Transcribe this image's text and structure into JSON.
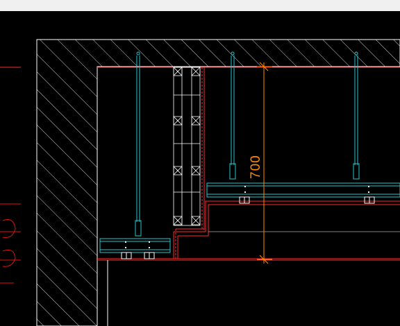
{
  "drawing": {
    "dimension_value": "700",
    "background_color": "#000000",
    "colors": {
      "wall_hatch": "#ffffff",
      "ceiling_line": "#ff2a2a",
      "hanger": "#25c7cf",
      "dimension": "#ff8c00",
      "accent_red": "#e01010"
    }
  }
}
